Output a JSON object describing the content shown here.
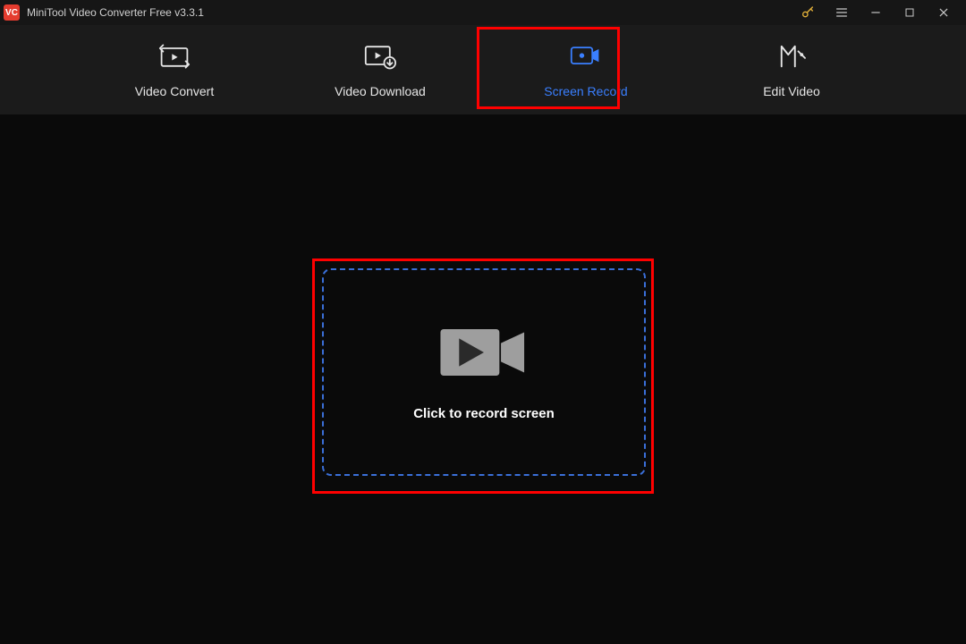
{
  "app": {
    "title": "MiniTool Video Converter Free v3.3.1",
    "logo_text": "VC"
  },
  "nav": {
    "items": [
      {
        "label": "Video Convert"
      },
      {
        "label": "Video Download"
      },
      {
        "label": "Screen Record"
      },
      {
        "label": "Edit Video"
      }
    ]
  },
  "main": {
    "record_prompt": "Click to record screen"
  },
  "colors": {
    "accent": "#3a7fff",
    "highlight": "#ff0000"
  }
}
